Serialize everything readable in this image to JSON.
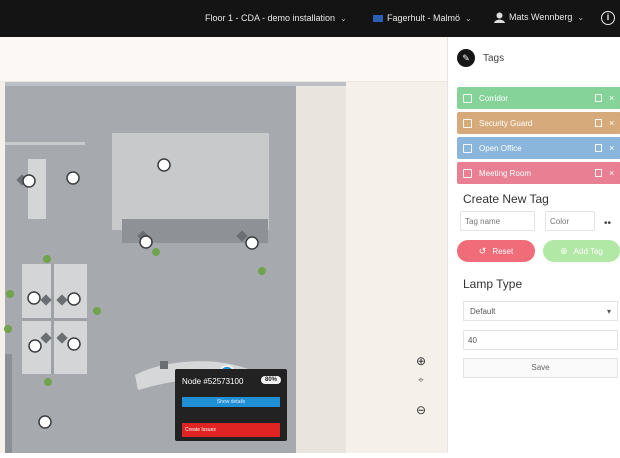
{
  "topbar": {
    "floor": "Floor 1 - CDA - demo installation",
    "building": "Fagerhult - Malmö",
    "user": "Mats Wennberg"
  },
  "tags_panel": {
    "title": "Tags",
    "tags": [
      {
        "label": "Corridor",
        "color": "#86d39a"
      },
      {
        "label": "Security Guard",
        "color": "#d6aa7a"
      },
      {
        "label": "Open Office",
        "color": "#8ab6dc"
      },
      {
        "label": "Meeting Room",
        "color": "#e87f93"
      }
    ],
    "create_title": "Create New Tag",
    "tag_name_placeholder": "Tag name",
    "color_placeholder": "Color",
    "more_label": "••",
    "reset_label": "Reset",
    "add_tag_label": "Add Tag",
    "reset_color": "#f06c78",
    "add_color": "#b2e8a5",
    "lamp_title": "Lamp Type",
    "lamp_select": "Default",
    "lamp_value": "40",
    "save_label": "Save"
  },
  "map": {
    "zoom_in": "⊕",
    "fit": "⌖",
    "zoom_out": "⊖",
    "popup": {
      "title": "Node #52573100",
      "badge": "80%",
      "blue_button": "Show details",
      "red_button": "Create Issues"
    }
  },
  "colors": {
    "topbar": "#141414",
    "floor_gray": "#a6a9ae",
    "room_gray": "#c7c9cb",
    "node_green": "#6fa34c",
    "node_blue": "#2a8fd3"
  }
}
